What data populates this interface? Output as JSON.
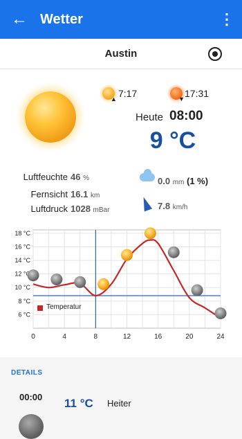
{
  "app": {
    "title": "Wetter"
  },
  "location": {
    "city": "Austin"
  },
  "sun": {
    "sunrise": "7:17",
    "sunset": "17:31"
  },
  "current": {
    "day_label": "Heute",
    "time": "08:00",
    "temperature": "9 °C",
    "humidity_label": "Luftfeuchte",
    "humidity_value": "46",
    "humidity_unit": "%",
    "visibility_label": "Fernsicht",
    "visibility_value": "16.1",
    "visibility_unit": "km",
    "pressure_label": "Luftdruck",
    "pressure_value": "1028",
    "pressure_unit": "mBar",
    "precip_value": "0.0",
    "precip_unit": "mm",
    "precip_pct": "(1 %)",
    "wind_value": "7.8",
    "wind_unit": "km/h"
  },
  "chart_data": {
    "type": "line",
    "x": [
      0,
      2,
      4,
      6,
      8,
      10,
      12,
      14,
      15,
      16,
      18,
      20,
      22,
      24
    ],
    "series": [
      {
        "name": "Temperatur",
        "color": "#c62828",
        "values": [
          10.5,
          10,
          10.4,
          10.6,
          8.8,
          10.5,
          14.2,
          16.5,
          17,
          16.5,
          12.5,
          8.5,
          7,
          5.5
        ]
      }
    ],
    "icon_points": [
      {
        "x": 0,
        "y": 11.8,
        "icon": "moon"
      },
      {
        "x": 3,
        "y": 11.2,
        "icon": "moon"
      },
      {
        "x": 6,
        "y": 10.8,
        "icon": "moon"
      },
      {
        "x": 9,
        "y": 10.5,
        "icon": "sun"
      },
      {
        "x": 12,
        "y": 14.8,
        "icon": "sun"
      },
      {
        "x": 15,
        "y": 18.0,
        "icon": "sun"
      },
      {
        "x": 18,
        "y": 15.2,
        "icon": "moon"
      },
      {
        "x": 21,
        "y": 9.6,
        "icon": "moon"
      },
      {
        "x": 24,
        "y": 6.2,
        "icon": "moon"
      }
    ],
    "xticks": [
      0,
      4,
      8,
      12,
      16,
      20,
      24
    ],
    "yticks": [
      6,
      8,
      10,
      12,
      14,
      16,
      18
    ],
    "ytick_labels": [
      "6 °C",
      "8 °C",
      "10 °C",
      "12 °C",
      "14 °C",
      "16 °C",
      "18 °C"
    ],
    "xlim": [
      0,
      24
    ],
    "ylim": [
      4,
      18.5
    ],
    "current_x": 8,
    "current_y": 8.8,
    "grid": true,
    "legend": "bottom-left"
  },
  "details": {
    "heading": "DETAILS",
    "time": "00:00",
    "temperature": "11 °C",
    "condition": "Heiter"
  }
}
